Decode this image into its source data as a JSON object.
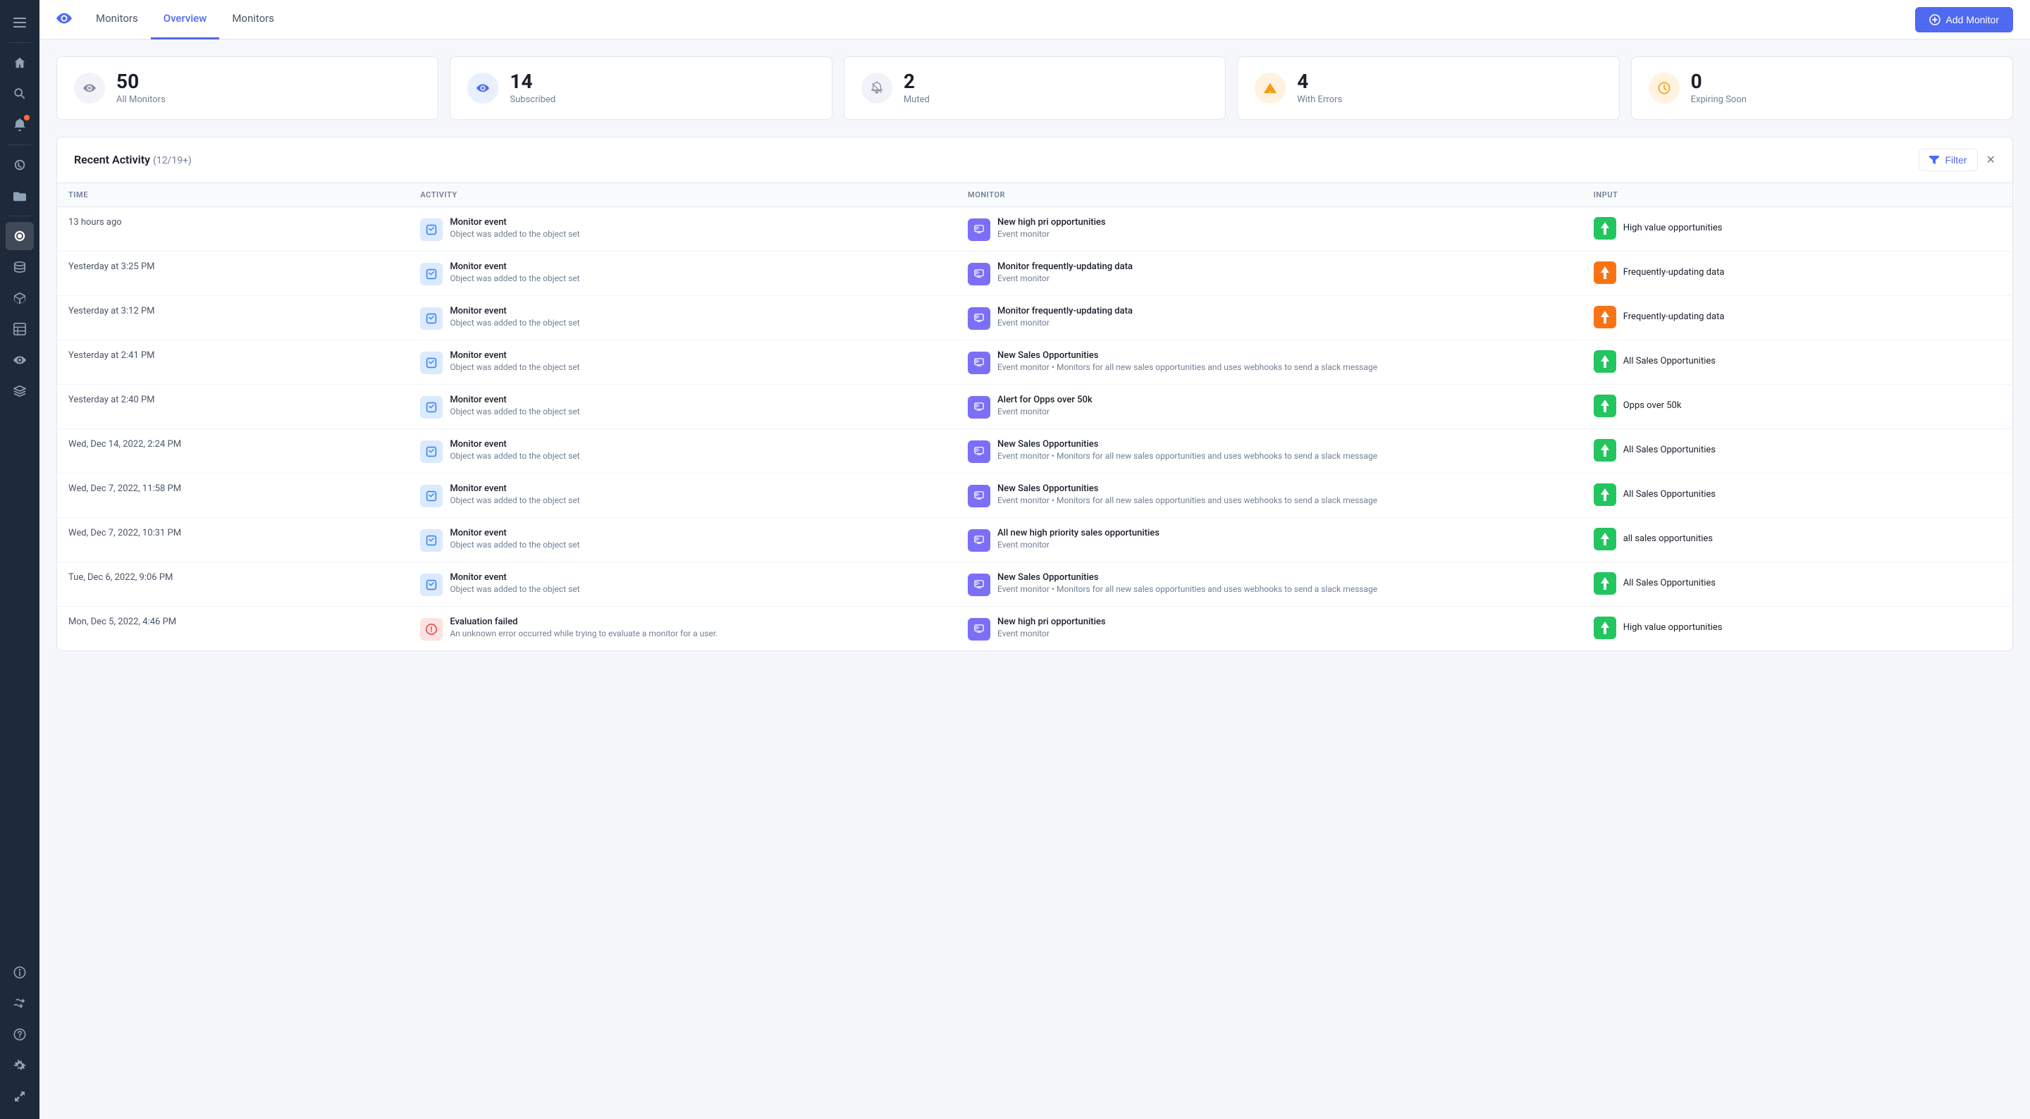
{
  "sidebar": {
    "icons": [
      {
        "name": "menu-icon",
        "symbol": "☰",
        "active": false
      },
      {
        "name": "home-icon",
        "symbol": "⌂",
        "active": false
      },
      {
        "name": "search-icon",
        "symbol": "🔍",
        "active": false
      },
      {
        "name": "bell-icon",
        "symbol": "🔔",
        "active": false,
        "badge": true
      },
      {
        "name": "history-icon",
        "symbol": "◷",
        "active": false
      },
      {
        "name": "folder-icon",
        "symbol": "📁",
        "active": false
      },
      {
        "name": "monitor-icon",
        "symbol": "👁",
        "active": true
      },
      {
        "name": "database-icon",
        "symbol": "🗄",
        "active": false
      },
      {
        "name": "cube-icon",
        "symbol": "◼",
        "active": false
      },
      {
        "name": "table-icon",
        "symbol": "▦",
        "active": false
      },
      {
        "name": "eye2-icon",
        "symbol": "◉",
        "active": false
      },
      {
        "name": "stack-icon",
        "symbol": "⊞",
        "active": false
      },
      {
        "name": "circle-icon",
        "symbol": "◎",
        "active": false
      },
      {
        "name": "shuffle-icon",
        "symbol": "⇄",
        "active": false
      },
      {
        "name": "question-icon",
        "symbol": "?",
        "active": false
      },
      {
        "name": "settings-icon",
        "symbol": "⚙",
        "active": false
      },
      {
        "name": "expand-icon",
        "symbol": "↗",
        "active": false
      }
    ]
  },
  "topnav": {
    "eye_icon": "👁",
    "tabs": [
      {
        "label": "Monitors",
        "active": false
      },
      {
        "label": "Overview",
        "active": true
      },
      {
        "label": "Monitors",
        "active": false
      }
    ],
    "add_button_label": "Add Monitor"
  },
  "stats": [
    {
      "icon": "👁",
      "icon_type": "eye",
      "number": "50",
      "label": "All Monitors"
    },
    {
      "icon": "👁",
      "icon_type": "eye",
      "number": "14",
      "label": "Subscribed"
    },
    {
      "icon": "🔕",
      "icon_type": "mute",
      "number": "2",
      "label": "Muted"
    },
    {
      "icon": "⚠",
      "icon_type": "warning",
      "number": "4",
      "label": "With Errors"
    },
    {
      "icon": "🕐",
      "icon_type": "clock",
      "number": "0",
      "label": "Expiring Soon"
    }
  ],
  "activity": {
    "title": "Recent Activity",
    "count": "(12/19+)",
    "filter_label": "Filter",
    "columns": [
      "TIME",
      "ACTIVITY",
      "MONITOR",
      "INPUT"
    ],
    "rows": [
      {
        "time": "13 hours ago",
        "activity_title": "Monitor event",
        "activity_sub": "Object was added to the object set",
        "activity_type": "event",
        "monitor_name": "New high pri opportunities",
        "monitor_type": "Event monitor",
        "monitor_desc": "",
        "input_name": "High value opportunities",
        "input_type": "green"
      },
      {
        "time": "Yesterday at 3:25 PM",
        "activity_title": "Monitor event",
        "activity_sub": "Object was added to the object set",
        "activity_type": "event",
        "monitor_name": "Monitor frequently-updating data",
        "monitor_type": "Event monitor",
        "monitor_desc": "",
        "input_name": "Frequently-updating data",
        "input_type": "orange"
      },
      {
        "time": "Yesterday at 3:12 PM",
        "activity_title": "Monitor event",
        "activity_sub": "Object was added to the object set",
        "activity_type": "event",
        "monitor_name": "Monitor frequently-updating data",
        "monitor_type": "Event monitor",
        "monitor_desc": "",
        "input_name": "Frequently-updating data",
        "input_type": "orange"
      },
      {
        "time": "Yesterday at 2:41 PM",
        "activity_title": "Monitor event",
        "activity_sub": "Object was added to the object set",
        "activity_type": "event",
        "monitor_name": "New Sales Opportunities",
        "monitor_type": "Event monitor",
        "monitor_desc": "Monitors for all new sales opportunities and uses webhooks to send a slack message",
        "input_name": "All Sales Opportunities",
        "input_type": "green"
      },
      {
        "time": "Yesterday at 2:40 PM",
        "activity_title": "Monitor event",
        "activity_sub": "Object was added to the object set",
        "activity_type": "event",
        "monitor_name": "Alert for Opps over 50k",
        "monitor_type": "Event monitor",
        "monitor_desc": "",
        "input_name": "Opps over 50k",
        "input_type": "green"
      },
      {
        "time": "Wed, Dec 14, 2022, 2:24 PM",
        "activity_title": "Monitor event",
        "activity_sub": "Object was added to the object set",
        "activity_type": "event",
        "monitor_name": "New Sales Opportunities",
        "monitor_type": "Event monitor",
        "monitor_desc": "Monitors for all new sales opportunities and uses webhooks to send a slack message",
        "input_name": "All Sales Opportunities",
        "input_type": "green"
      },
      {
        "time": "Wed, Dec 7, 2022, 11:58 PM",
        "activity_title": "Monitor event",
        "activity_sub": "Object was added to the object set",
        "activity_type": "event",
        "monitor_name": "New Sales Opportunities",
        "monitor_type": "Event monitor",
        "monitor_desc": "Monitors for all new sales opportunities and uses webhooks to send a slack message",
        "input_name": "All Sales Opportunities",
        "input_type": "green"
      },
      {
        "time": "Wed, Dec 7, 2022, 10:31 PM",
        "activity_title": "Monitor event",
        "activity_sub": "Object was added to the object set",
        "activity_type": "event",
        "monitor_name": "All new high priority sales opportunities",
        "monitor_type": "Event monitor",
        "monitor_desc": "",
        "input_name": "all sales opportunities",
        "input_type": "green"
      },
      {
        "time": "Tue, Dec 6, 2022, 9:06 PM",
        "activity_title": "Monitor event",
        "activity_sub": "Object was added to the object set",
        "activity_type": "event",
        "monitor_name": "New Sales Opportunities",
        "monitor_type": "Event monitor",
        "monitor_desc": "Monitors for all new sales opportunities and uses webhooks to send a slack message",
        "input_name": "All Sales Opportunities",
        "input_type": "green"
      },
      {
        "time": "Mon, Dec 5, 2022, 4:46 PM",
        "activity_title": "Evaluation failed",
        "activity_sub": "An unknown error occurred while trying to evaluate a monitor for a user.",
        "activity_type": "error",
        "monitor_name": "New high pri opportunities",
        "monitor_type": "Event monitor",
        "monitor_desc": "",
        "input_name": "High value opportunities",
        "input_type": "green"
      }
    ]
  }
}
